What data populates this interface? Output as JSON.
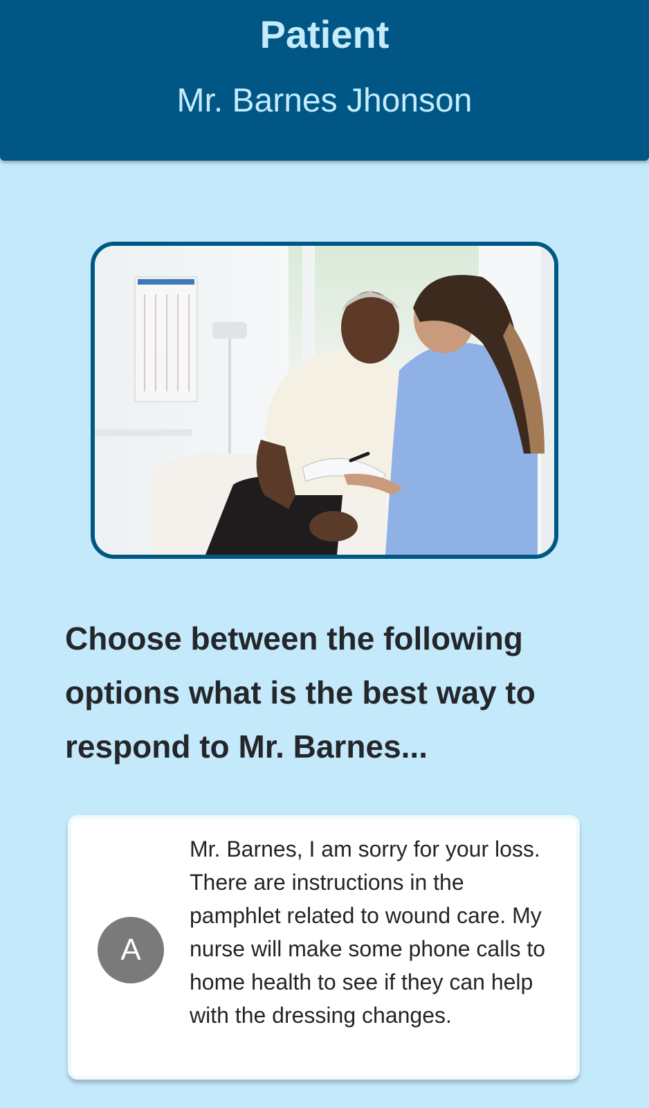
{
  "header": {
    "title": "Patient",
    "subtitle": "Mr. Barnes Jhonson"
  },
  "colors": {
    "header_bg": "#005786",
    "header_text": "#c6ecfb",
    "page_bg": "#c3e9fb",
    "option_badge": "#7a7a7a"
  },
  "question": {
    "text": "Choose between the following options what is the best way to respond to Mr. Barnes..."
  },
  "options": [
    {
      "letter": "A",
      "text": "Mr. Barnes, I am sorry for your loss. There are instructions in the pamphlet related to wound care. My nurse will make some phone calls to home health to see if they can help with the dressing changes."
    }
  ]
}
